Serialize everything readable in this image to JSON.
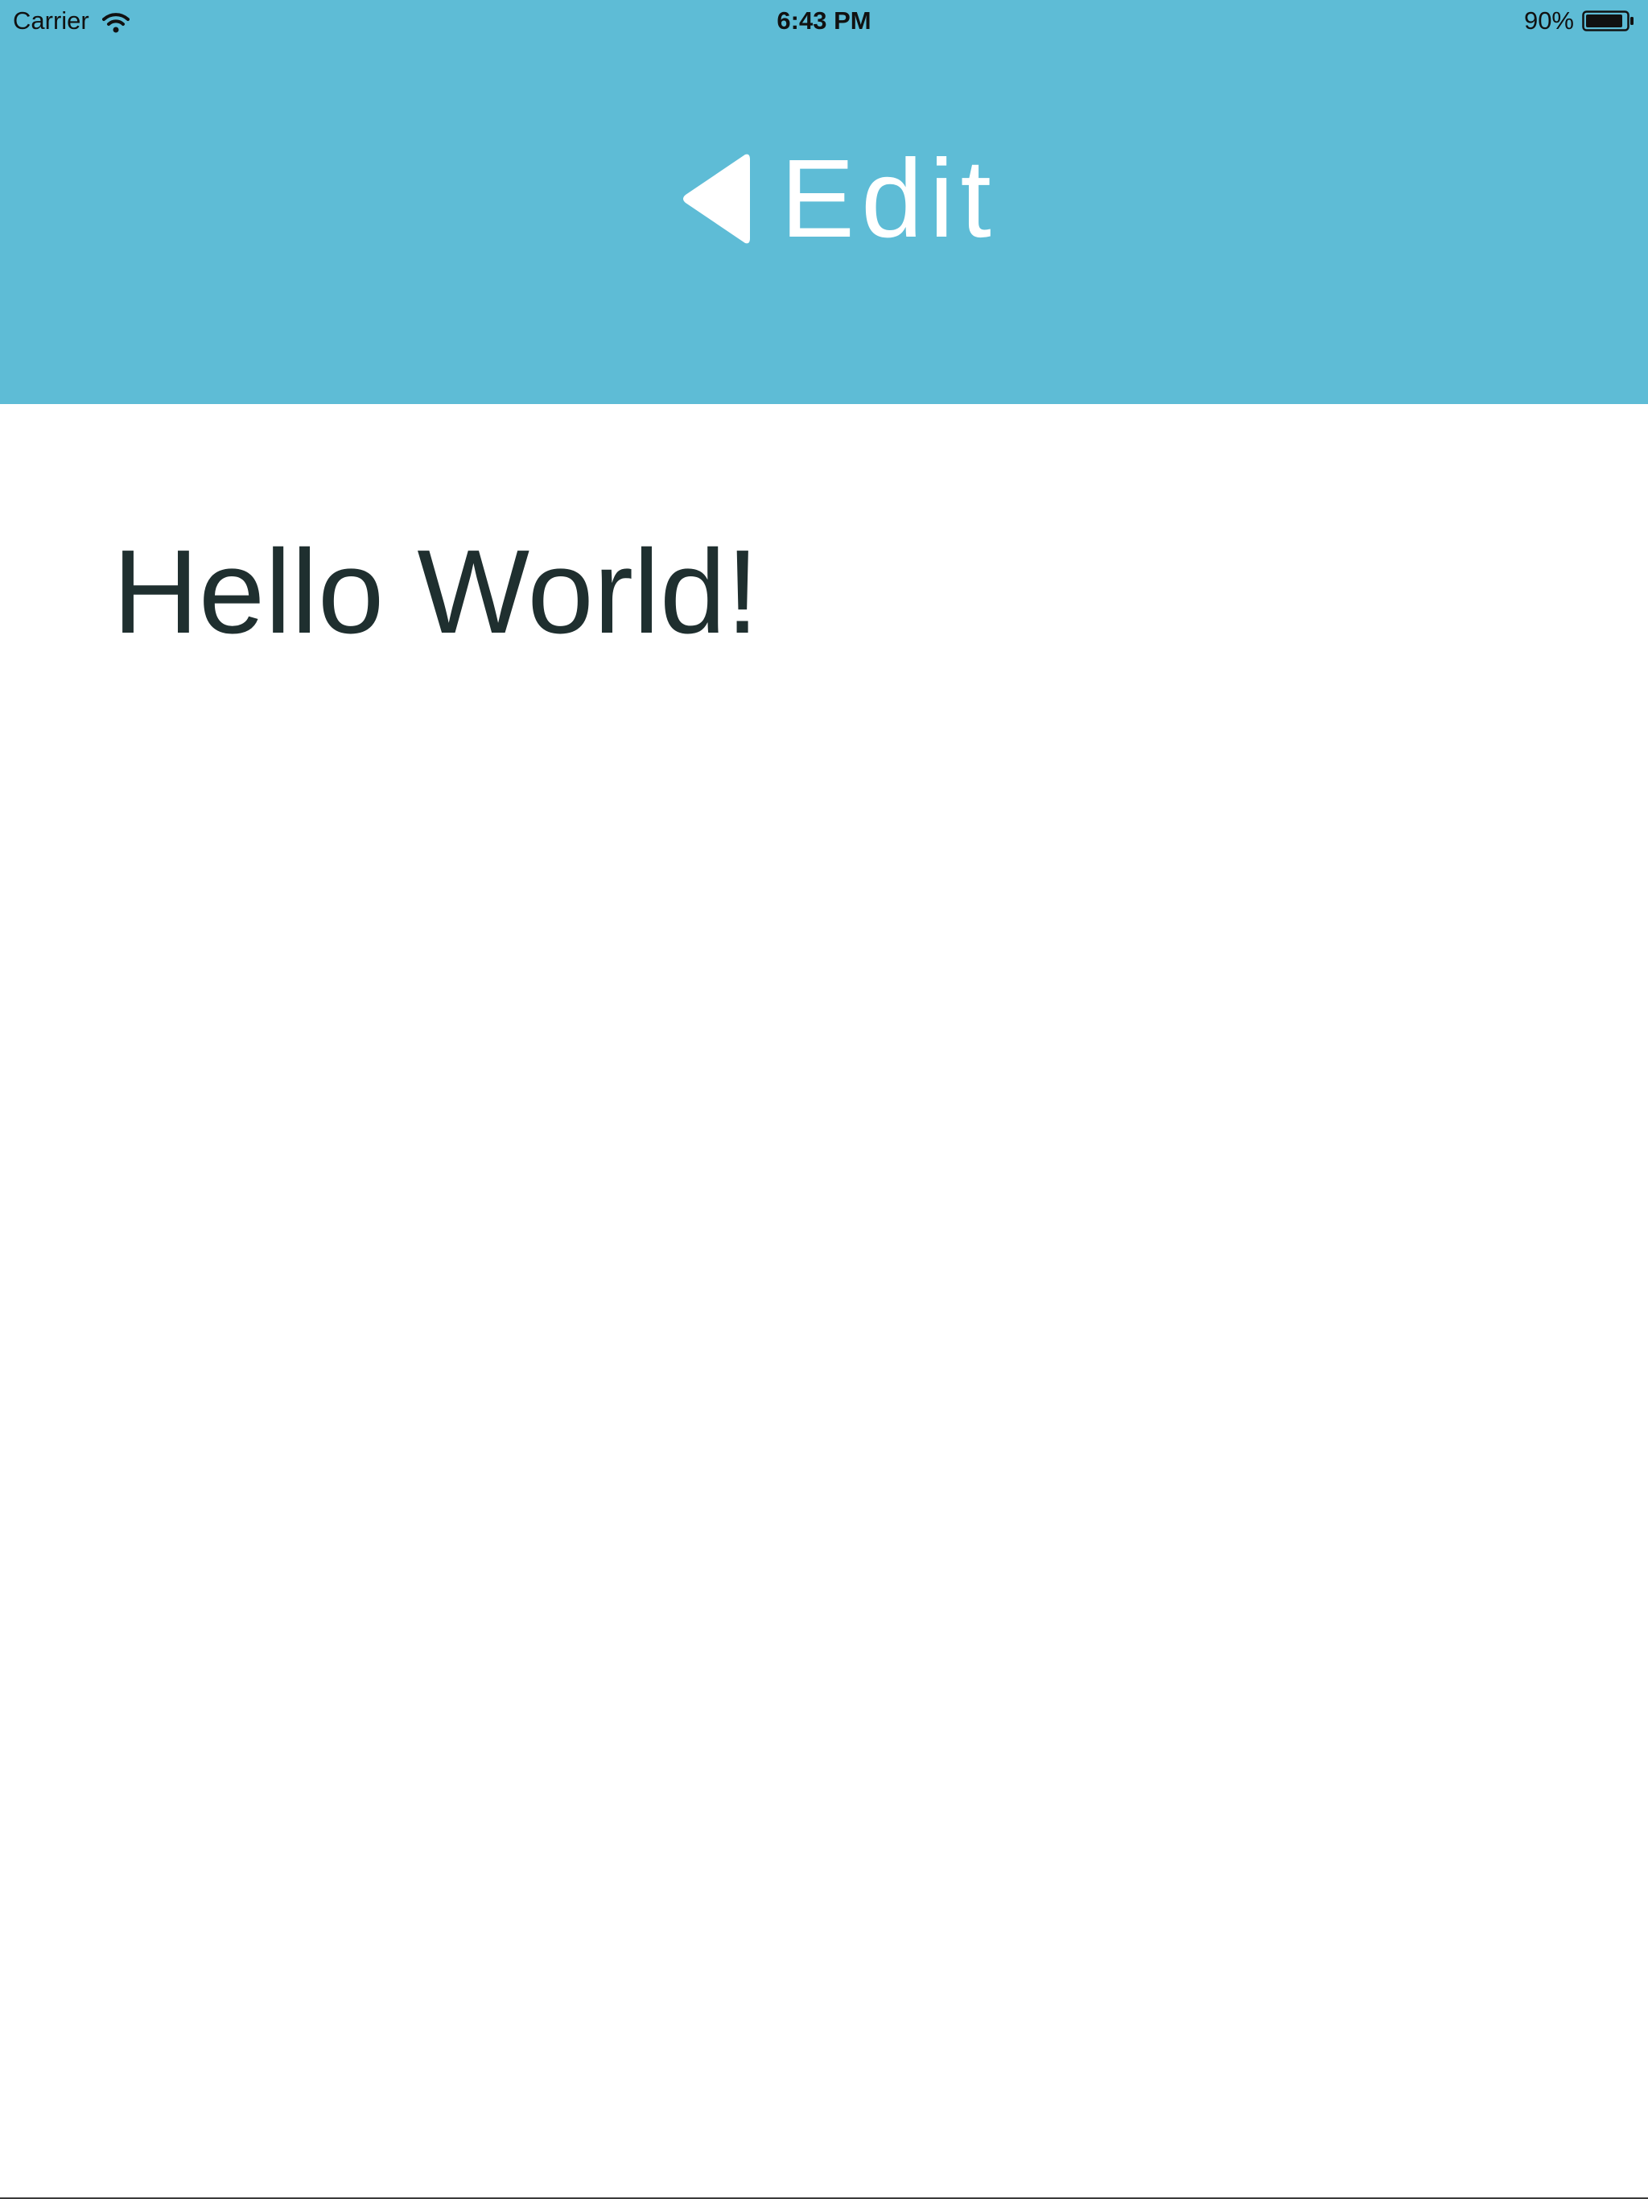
{
  "status_bar": {
    "carrier": "Carrier",
    "time": "6:43 PM",
    "battery_percent": "90%",
    "battery_level": 0.9,
    "icons": [
      "wifi-icon",
      "battery-icon"
    ]
  },
  "nav": {
    "back_icon": "back-arrow-icon",
    "title": "Edit"
  },
  "main": {
    "greeting": "Hello World!"
  },
  "colors": {
    "header_background": "#5ebcd6",
    "header_text": "#ffffff",
    "body_text": "#1f2f2f",
    "page_background": "#ffffff"
  }
}
